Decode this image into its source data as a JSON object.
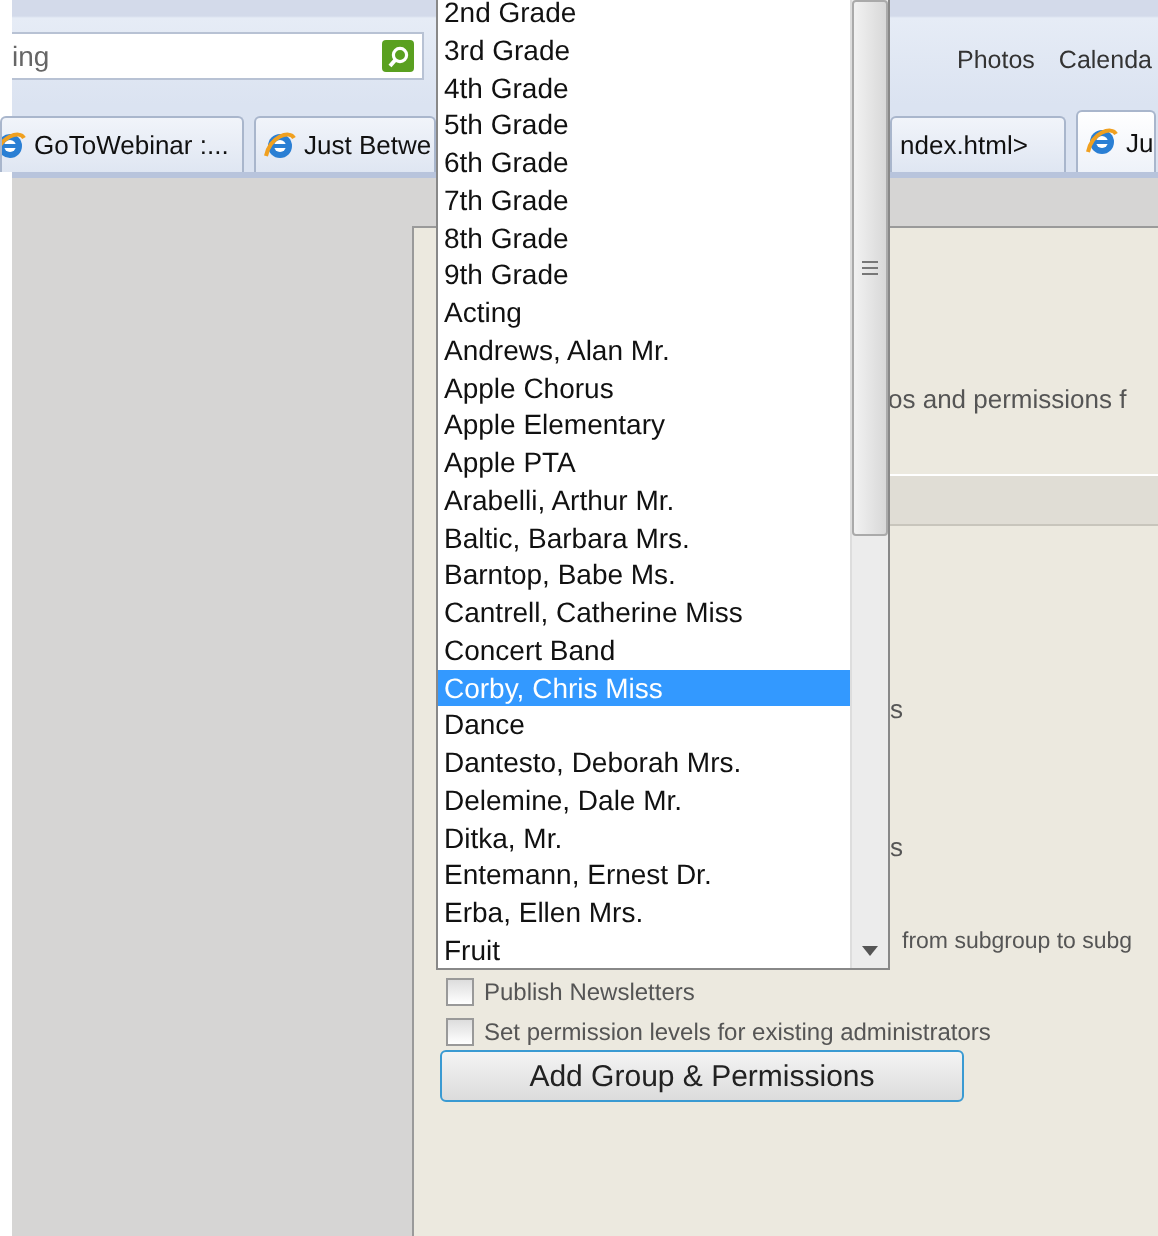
{
  "search": {
    "value": "ing"
  },
  "menu": [
    "Photos",
    "Calenda"
  ],
  "tabs": [
    {
      "label": "GoToWebinar :...",
      "selected": false,
      "kind": "ie"
    },
    {
      "label": "Just Betwe",
      "selected": false,
      "kind": "ie"
    },
    {
      "label": "ndex.html>",
      "selected": false,
      "kind": "plain"
    },
    {
      "label": "Ju",
      "selected": true,
      "kind": "ie"
    }
  ],
  "dropdown": {
    "items": [
      {
        "label": "2nd Grade",
        "selected": false
      },
      {
        "label": "3rd Grade",
        "selected": false
      },
      {
        "label": "4th Grade",
        "selected": false
      },
      {
        "label": "5th Grade",
        "selected": false
      },
      {
        "label": "6th Grade",
        "selected": false
      },
      {
        "label": "7th Grade",
        "selected": false
      },
      {
        "label": "8th Grade",
        "selected": false
      },
      {
        "label": "9th Grade",
        "selected": false
      },
      {
        "label": "Acting",
        "selected": false
      },
      {
        "label": "Andrews, Alan Mr.",
        "selected": false
      },
      {
        "label": "Apple Chorus",
        "selected": false
      },
      {
        "label": "Apple Elementary",
        "selected": false
      },
      {
        "label": "Apple PTA",
        "selected": false
      },
      {
        "label": "Arabelli, Arthur Mr.",
        "selected": false
      },
      {
        "label": "Baltic, Barbara Mrs.",
        "selected": false
      },
      {
        "label": "Barntop, Babe Ms.",
        "selected": false
      },
      {
        "label": "Cantrell, Catherine Miss",
        "selected": false
      },
      {
        "label": "Concert Band",
        "selected": false
      },
      {
        "label": "Corby, Chris Miss",
        "selected": true
      },
      {
        "label": "Dance",
        "selected": false
      },
      {
        "label": "Dantesto, Deborah Mrs.",
        "selected": false
      },
      {
        "label": "Delemine, Dale Mr.",
        "selected": false
      },
      {
        "label": "Ditka, Mr.",
        "selected": false
      },
      {
        "label": "Entemann, Ernest Dr.",
        "selected": false
      },
      {
        "label": "Erba, Ellen Mrs.",
        "selected": false
      },
      {
        "label": "Fruit",
        "selected": false
      }
    ]
  },
  "panel": {
    "intro": "os and permissions f",
    "label_1": "s",
    "label_2": "s",
    "label_3": "from subgroup to subg"
  },
  "options": [
    {
      "label": "Publish Newsletters",
      "checked": false
    },
    {
      "label": "Set permission levels for existing administrators",
      "checked": false
    }
  ],
  "button": "Add Group & Permissions"
}
